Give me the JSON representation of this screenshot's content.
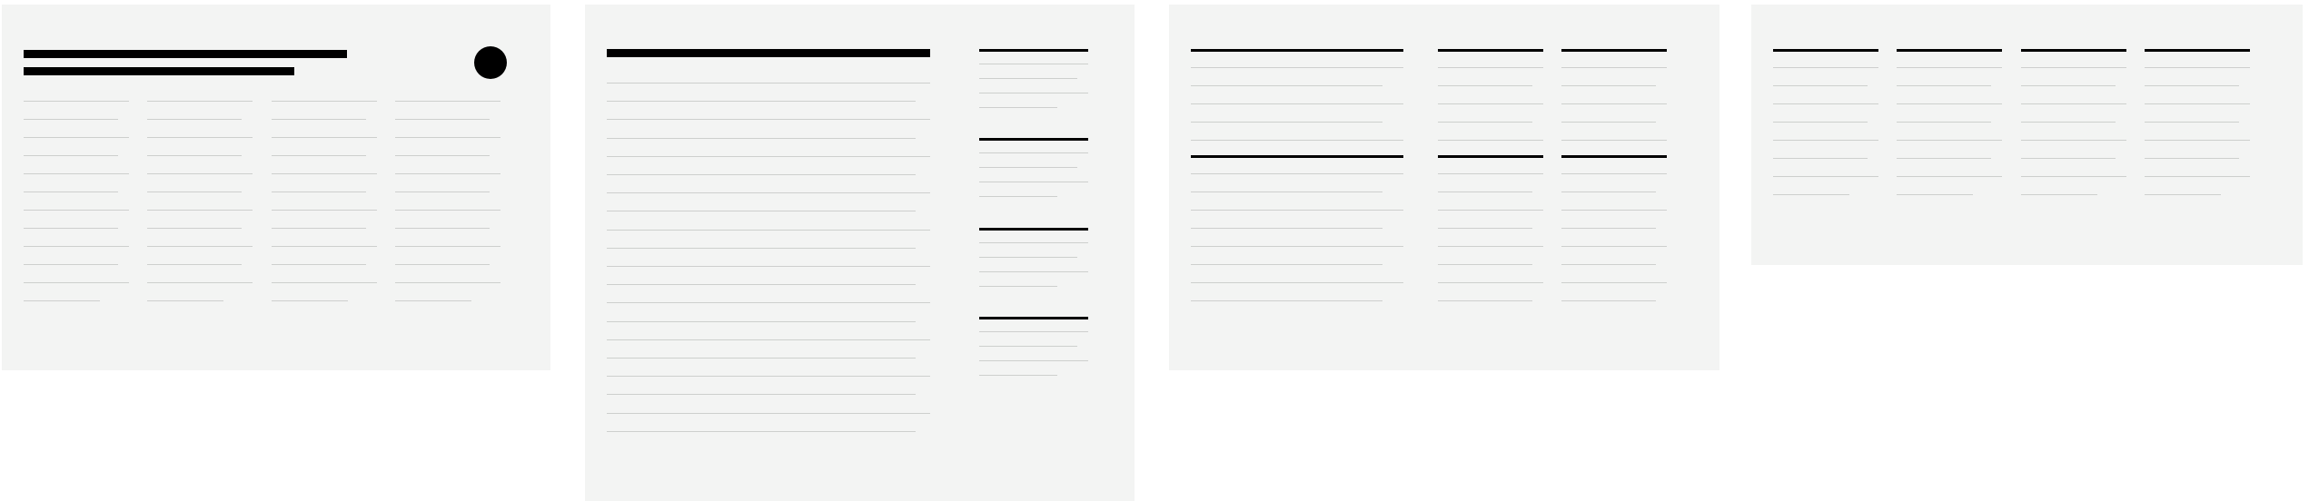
{
  "screen": {
    "panels": [
      {
        "name": "wireframe-four-column-grid"
      },
      {
        "name": "wireframe-article-with-sidebar"
      },
      {
        "name": "wireframe-three-column-sections"
      },
      {
        "name": "wireframe-four-column-lists"
      }
    ]
  },
  "colors": {
    "panel_background": "#f3f4f3",
    "placeholder_heading": "#000000",
    "placeholder_text_line": "#cdcfcd",
    "page_background": "#ffffff"
  },
  "icons": [
    "circle-icon"
  ]
}
